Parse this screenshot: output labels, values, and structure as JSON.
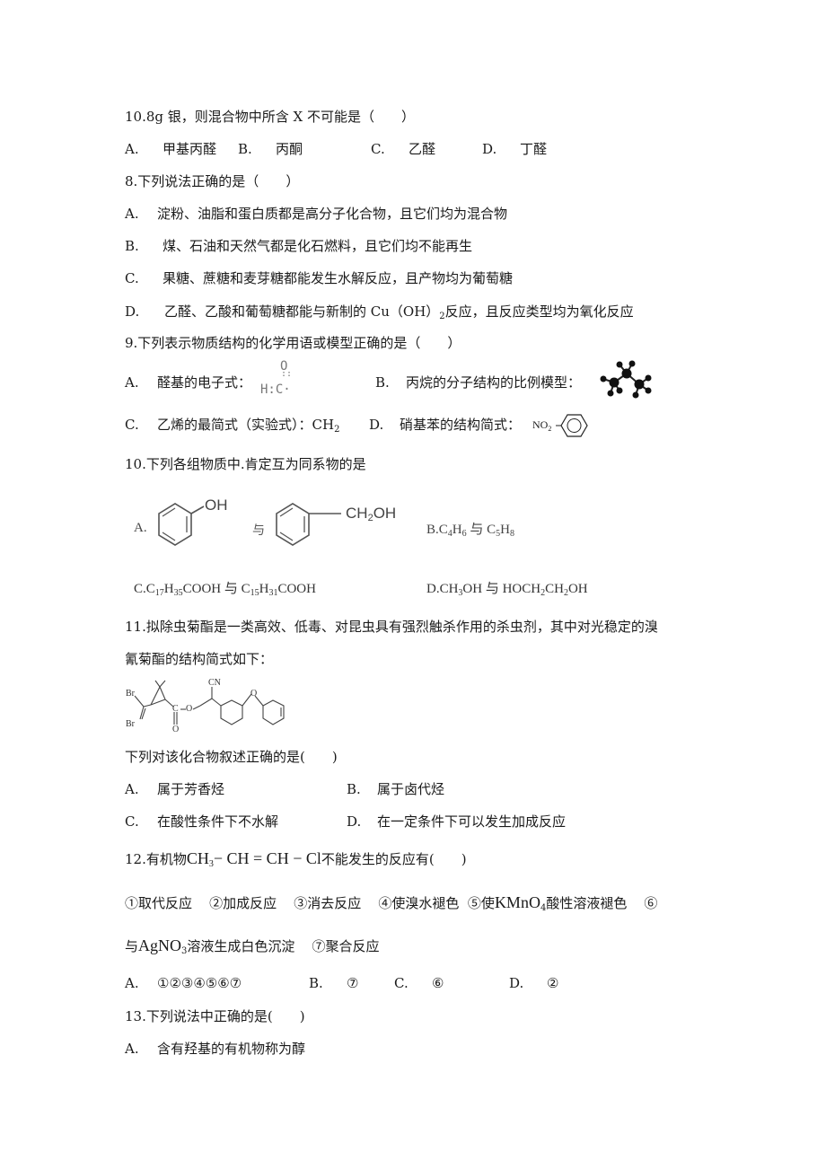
{
  "prev_question_tail": {
    "stem": "10.8g 银，则混合物中所含 X 不可能是（　　）",
    "options": [
      {
        "label": "A.",
        "text": "甲基丙醛"
      },
      {
        "label": "B.",
        "text": "丙酮"
      },
      {
        "label": "C.",
        "text": "乙醛"
      },
      {
        "label": "D.",
        "text": "丁醛"
      }
    ]
  },
  "q8": {
    "stem": "8.下列说法正确的是（　　）",
    "options": [
      {
        "label": "A.",
        "text": "淀粉、油脂和蛋白质都是高分子化合物，且它们均为混合物"
      },
      {
        "label": "B.",
        "text": "煤、石油和天然气都是化石燃料，且它们均不能再生"
      },
      {
        "label": "C.",
        "text": "果糖、蔗糖和麦芽糖都能发生水解反应，且产物均为葡萄糖"
      },
      {
        "label": "D.",
        "text_before": "乙醛、乙酸和葡萄糖都能与新制的 Cu（OH）",
        "sub": "2",
        "text_after": "反应，且反应类型均为氧化反应"
      }
    ]
  },
  "q9": {
    "stem": "9.下列表示物质结构的化学用语或模型正确的是（　　）",
    "options": [
      {
        "label": "A.",
        "text": "醛基的电子式：",
        "figure": "aldehyde-electron-formula",
        "fig_top": "O",
        "fig_bottom": "H:C·"
      },
      {
        "label": "B.",
        "text": "丙烷的分子结构的比例模型：",
        "figure": "propane-ball-model"
      },
      {
        "label": "C.",
        "text": "乙烯的最简式（实验式）：CH",
        "sub": "2"
      },
      {
        "label": "D.",
        "text": "硝基苯的结构简式：",
        "figure": "nitrobenzene-structure",
        "fig_text": "NO",
        "fig_sub": "2"
      }
    ]
  },
  "q10": {
    "stem": "10.下列各组物质中.肯定互为同系物的是",
    "options": {
      "A": {
        "label": "A.",
        "left_group": "OH",
        "connector": "与",
        "right_group": "CH",
        "right_sub": "2",
        "right_tail": "OH"
      },
      "B": {
        "label": "B.C",
        "parts": [
          "B.C",
          "4",
          "H",
          "6",
          " 与 C",
          "5",
          "H",
          "8"
        ]
      },
      "C": {
        "parts": [
          "C.C",
          "17",
          "H",
          "35",
          "COOH 与 C",
          "15",
          "H",
          "31",
          "COOH"
        ]
      },
      "D": {
        "parts": [
          "D.CH",
          "3",
          "OH 与 HOCH",
          "2",
          "CH",
          "2",
          "OH"
        ]
      }
    }
  },
  "q11": {
    "stem_line1": "11.拟除虫菊酯是一类高效、低毒、对昆虫具有强烈触杀作用的杀虫剂，其中对光稳定的溴",
    "stem_line2": "氰菊酯的结构简式如下：",
    "figure_labels": {
      "br1": "Br",
      "br2": "Br",
      "cn": "CN",
      "c": "C",
      "o_ester": "O",
      "o_carbonyl": "O",
      "o_ether": "O"
    },
    "question": "下列对该化合物叙述正确的是(　　)",
    "options": [
      {
        "label": "A.",
        "text": "属于芳香烃"
      },
      {
        "label": "B.",
        "text": "属于卤代烃"
      },
      {
        "label": "C.",
        "text": "在酸性条件下不水解"
      },
      {
        "label": "D.",
        "text": "在一定条件下可以发生加成反应"
      }
    ]
  },
  "q12": {
    "stem_prefix": "12.有机物",
    "formula": {
      "a": "CH",
      "a_sub": "3",
      "b": "− CH = CH − Cl"
    },
    "stem_suffix": "不能发生的反应有(　　)",
    "items_line1": [
      {
        "num": "①",
        "text": "取代反应"
      },
      {
        "num": "②",
        "text": "加成反应"
      },
      {
        "num": "③",
        "text": "消去反应"
      },
      {
        "num": "④",
        "text": "使溴水褪色"
      },
      {
        "num": "⑤",
        "text_before": "使",
        "formula": "KMnO",
        "sub": "4",
        "text_after": "酸性溶液褪色"
      },
      {
        "num": "⑥",
        "text": ""
      }
    ],
    "items_line2": {
      "text_before": "与",
      "formula": "AgNO",
      "sub": "3",
      "text_after": "溶液生成白色沉淀",
      "item7_num": "⑦",
      "item7_text": "聚合反应"
    },
    "options": [
      {
        "label": "A.",
        "text": "①②③④⑤⑥⑦"
      },
      {
        "label": "B.",
        "text": "⑦"
      },
      {
        "label": "C.",
        "text": "⑥"
      },
      {
        "label": "D.",
        "text": "②"
      }
    ]
  },
  "q13": {
    "stem": "13.下列说法中正确的是(　　)",
    "options": [
      {
        "label": "A.",
        "text": "含有羟基的有机物称为醇"
      }
    ]
  }
}
